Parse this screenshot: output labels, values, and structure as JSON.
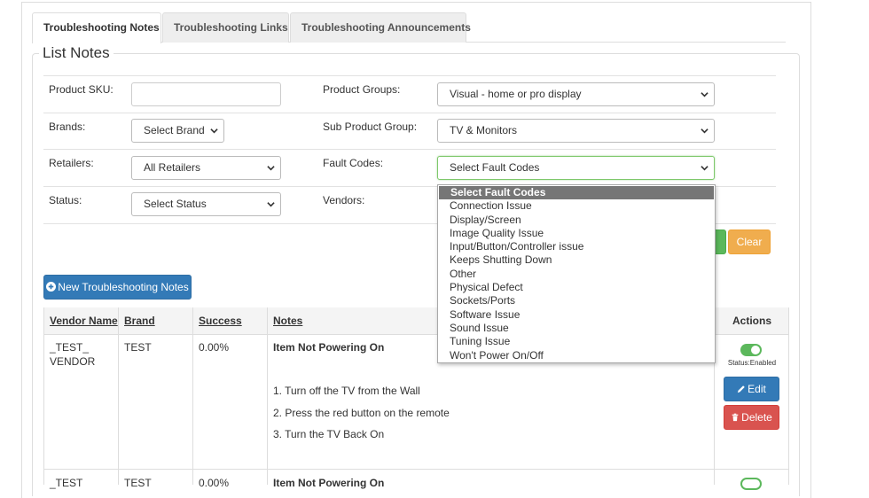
{
  "tabs": [
    {
      "label": "Troubleshooting Notes"
    },
    {
      "label": "Troubleshooting Links"
    },
    {
      "label": "Troubleshooting Announcements"
    }
  ],
  "section_title": "List Notes",
  "filters": {
    "product_sku": {
      "label": "Product SKU:",
      "value": ""
    },
    "product_groups": {
      "label": "Product Groups:",
      "value": "Visual - home or pro display"
    },
    "brands": {
      "label": "Brands:",
      "value": "Select Brand"
    },
    "sub_product_group": {
      "label": "Sub Product Group:",
      "value": "TV & Monitors"
    },
    "retailers": {
      "label": "Retailers:",
      "value": "All Retailers"
    },
    "fault_codes": {
      "label": "Fault Codes:",
      "value": "Select Fault Codes"
    },
    "status": {
      "label": "Status:",
      "value": "Select Status"
    },
    "vendors": {
      "label": "Vendors:"
    }
  },
  "fault_code_options": [
    "Select Fault Codes",
    "Connection Issue",
    "Display/Screen",
    "Image Quality Issue",
    "Input/Button/Controller issue",
    "Keeps Shutting Down",
    "Other",
    "Physical Defect",
    "Sockets/Ports",
    "Software Issue",
    "Sound Issue",
    "Tuning Issue",
    "Won't Power On/Off"
  ],
  "buttons": {
    "clear": "Clear",
    "new_notes": "New Troubleshooting Notes",
    "edit": "Edit",
    "delete": "Delete"
  },
  "table": {
    "headers": {
      "vendor_name": "Vendor Name",
      "brand": "Brand",
      "success": "Success",
      "notes": "Notes",
      "actions": "Actions"
    },
    "rows": [
      {
        "vendor_line1": "_TEST_",
        "vendor_line2": "VENDOR",
        "brand": "TEST",
        "success": "0.00%",
        "note_title": "Item Not Powering On",
        "steps": [
          "1. Turn off the TV from the Wall",
          "2. Press the red button on the remote",
          "3. Turn the TV Back On"
        ],
        "status": "Status:Enabled"
      },
      {
        "vendor_line1": "_TEST",
        "brand": "TEST",
        "success": "0.00%",
        "note_title": "Item Not Powering On"
      }
    ]
  },
  "colors": {
    "primary": "#337ab7",
    "warning": "#f0ad4e",
    "success": "#5cb85c",
    "danger": "#d9534f",
    "selected_option": "#767676"
  }
}
